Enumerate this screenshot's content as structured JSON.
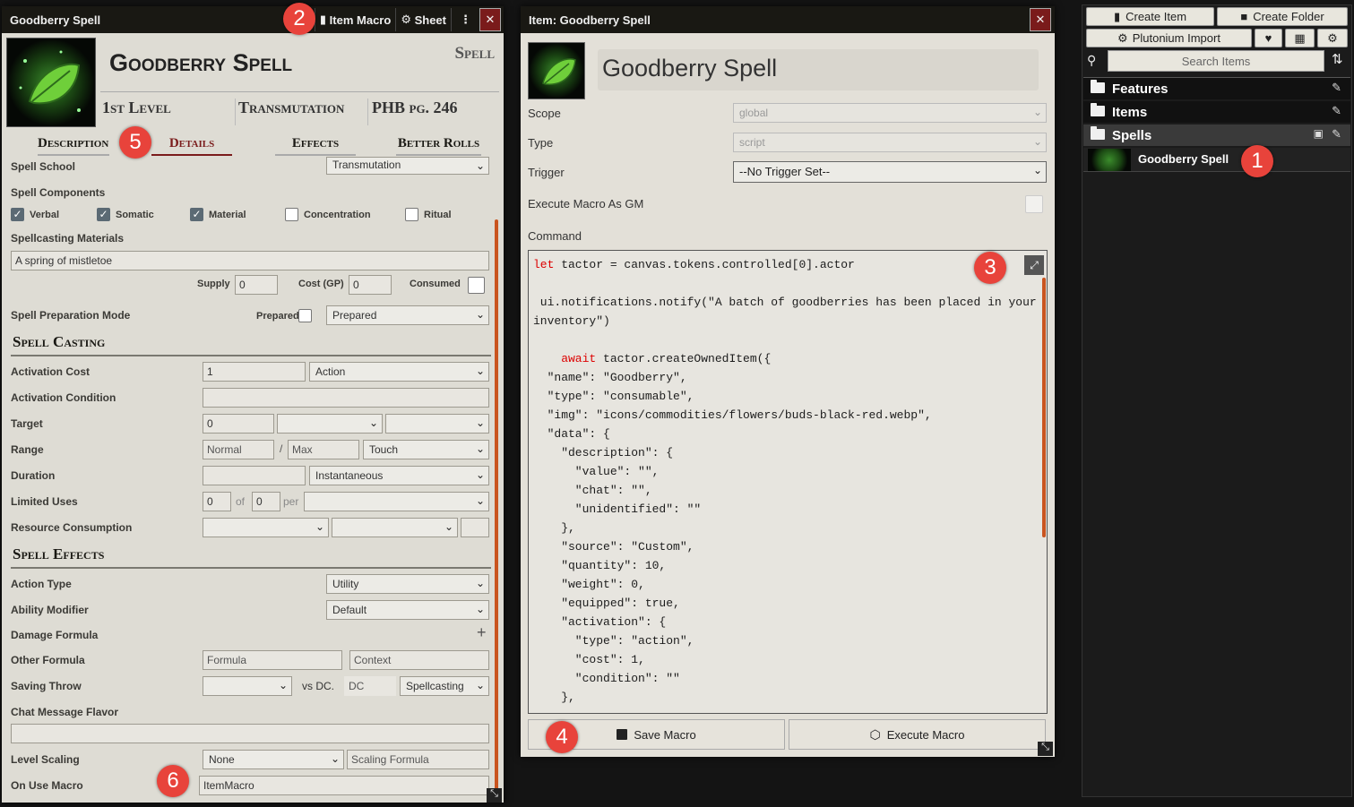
{
  "sheet": {
    "title": "Goodberry Spell",
    "header_buttons": {
      "item_macro": "Item Macro",
      "sheet": "Sheet"
    },
    "name": "Goodberry Spell",
    "type": "Spell",
    "level": "1st Level",
    "school": "Transmutation",
    "source": "PHB pg. 246",
    "tabs": [
      "Description",
      "Details",
      "Effects",
      "Better Rolls"
    ],
    "spell_school_label": "Spell School",
    "spell_school_value": "Transmutation",
    "components_label": "Spell Components",
    "components": [
      {
        "label": "Verbal",
        "checked": true
      },
      {
        "label": "Somatic",
        "checked": true
      },
      {
        "label": "Material",
        "checked": true
      },
      {
        "label": "Concentration",
        "checked": false
      },
      {
        "label": "Ritual",
        "checked": false
      }
    ],
    "materials_label": "Spellcasting Materials",
    "materials_value": "A spring of mistletoe",
    "supply_label": "Supply",
    "supply_value": "0",
    "cost_label": "Cost (GP)",
    "cost_value": "0",
    "consumed_label": "Consumed",
    "prep_mode_label": "Spell Preparation Mode",
    "prepared_label": "Prepared",
    "prep_mode_value": "Prepared",
    "casting_section": "Spell Casting",
    "activation_cost_label": "Activation Cost",
    "activation_cost_value": "1",
    "activation_type_value": "Action",
    "activation_condition_label": "Activation Condition",
    "target_label": "Target",
    "target_value": "0",
    "range_label": "Range",
    "range_normal": "Normal",
    "range_sep": "/",
    "range_max": "Max",
    "range_units": "Touch",
    "duration_label": "Duration",
    "duration_value": "",
    "duration_units": "Instantaneous",
    "limited_uses_label": "Limited Uses",
    "uses_value": "0",
    "uses_of": "of",
    "uses_max": "0",
    "uses_per": "per",
    "resource_label": "Resource Consumption",
    "effects_section": "Spell Effects",
    "action_type_label": "Action Type",
    "action_type_value": "Utility",
    "ability_label": "Ability Modifier",
    "ability_value": "Default",
    "damage_label": "Damage Formula",
    "other_label": "Other Formula",
    "other_formula_placeholder": "Formula",
    "other_context_placeholder": "Context",
    "saving_label": "Saving Throw",
    "vs_dc": "vs DC.",
    "dc_placeholder": "DC",
    "saving_scaling": "Spellcasting",
    "flavor_label": "Chat Message Flavor",
    "level_scaling_label": "Level Scaling",
    "level_scaling_value": "None",
    "scaling_formula_placeholder": "Scaling Formula",
    "on_use_label": "On Use Macro",
    "on_use_value": "ItemMacro"
  },
  "macro": {
    "title": "Item: Goodberry Spell",
    "name": "Goodberry Spell",
    "scope_label": "Scope",
    "scope_value": "global",
    "type_label": "Type",
    "type_value": "script",
    "trigger_label": "Trigger",
    "trigger_value": "--No Trigger Set--",
    "gm_label": "Execute Macro As GM",
    "command_label": "Command",
    "code_lines": [
      {
        "kw": "let",
        "text": " tactor = canvas.tokens.controlled[0].actor"
      },
      {
        "kw": "",
        "text": ""
      },
      {
        "kw": "",
        "text": " ui.notifications.notify(\"A batch of goodberries has been placed in your"
      },
      {
        "kw": "",
        "text": "inventory\")"
      },
      {
        "kw": "",
        "text": ""
      },
      {
        "kw": "    await",
        "text": " tactor.createOwnedItem({"
      },
      {
        "kw": "",
        "text": "  \"name\": \"Goodberry\","
      },
      {
        "kw": "",
        "text": "  \"type\": \"consumable\","
      },
      {
        "kw": "",
        "text": "  \"img\": \"icons/commodities/flowers/buds-black-red.webp\","
      },
      {
        "kw": "",
        "text": "  \"data\": {"
      },
      {
        "kw": "",
        "text": "    \"description\": {"
      },
      {
        "kw": "",
        "text": "      \"value\": \"\","
      },
      {
        "kw": "",
        "text": "      \"chat\": \"\","
      },
      {
        "kw": "",
        "text": "      \"unidentified\": \"\""
      },
      {
        "kw": "",
        "text": "    },"
      },
      {
        "kw": "",
        "text": "    \"source\": \"Custom\","
      },
      {
        "kw": "",
        "text": "    \"quantity\": 10,"
      },
      {
        "kw": "",
        "text": "    \"weight\": 0,"
      },
      {
        "kw": "",
        "text": "    \"equipped\": true,"
      },
      {
        "kw": "",
        "text": "    \"activation\": {"
      },
      {
        "kw": "",
        "text": "      \"type\": \"action\","
      },
      {
        "kw": "",
        "text": "      \"cost\": 1,"
      },
      {
        "kw": "",
        "text": "      \"condition\": \"\""
      },
      {
        "kw": "",
        "text": "    },"
      }
    ],
    "save_label": "Save Macro",
    "execute_label": "Execute Macro"
  },
  "sidebar": {
    "create_item": "Create Item",
    "create_folder": "Create Folder",
    "plutonium_import": "Plutonium Import",
    "search_placeholder": "Search Items",
    "folders": [
      "Features",
      "Items",
      "Spells"
    ],
    "spell_entry": "Goodberry Spell"
  },
  "badges": [
    "1",
    "2",
    "3",
    "4",
    "5",
    "6"
  ],
  "colors": {
    "accent": "#e8433b",
    "tab_active": "#7a1b1b",
    "scrollbar": "#c9541f"
  }
}
